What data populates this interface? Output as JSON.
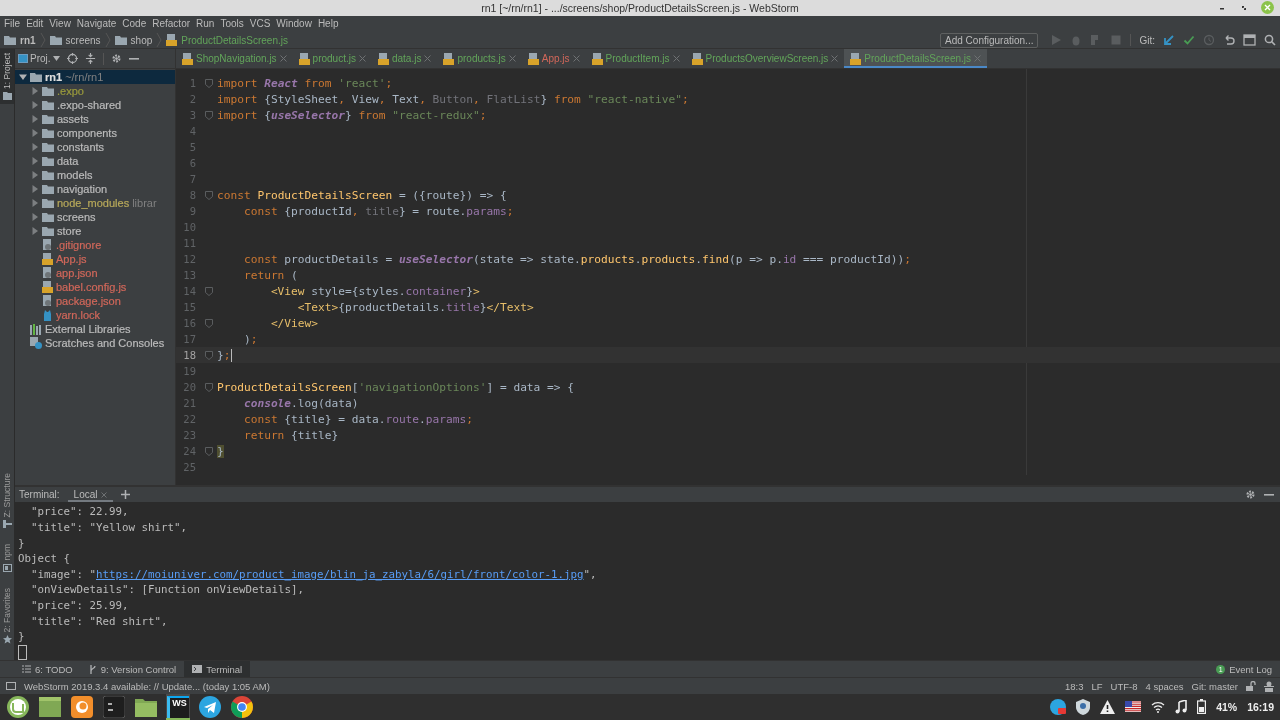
{
  "window": {
    "title": "rn1 [~/rn/rn1] - .../screens/shop/ProductDetailsScreen.js - WebStorm"
  },
  "menu": [
    "File",
    "Edit",
    "View",
    "Navigate",
    "Code",
    "Refactor",
    "Run",
    "Tools",
    "VCS",
    "Window",
    "Help"
  ],
  "breadcrumbs": [
    {
      "label": "rn1",
      "kind": "root"
    },
    {
      "label": "screens",
      "kind": "folder"
    },
    {
      "label": "shop",
      "kind": "folder"
    },
    {
      "label": "ProductDetailsScreen.js",
      "kind": "file"
    }
  ],
  "toolbar": {
    "config_button": "Add Configuration...",
    "git_label": "Git:"
  },
  "side_tools": [
    {
      "label": "1: Project",
      "kind": "project",
      "selected": true
    },
    {
      "label": "Z: Structure",
      "kind": "structure",
      "selected": false
    },
    {
      "label": "npm",
      "kind": "npm",
      "selected": false
    },
    {
      "label": "2: Favorites",
      "kind": "favorites",
      "selected": false
    }
  ],
  "project_panel": {
    "view": "Proj."
  },
  "project_tree": [
    {
      "label": "rn1",
      "hint": "~/rn/rn1",
      "kind": "root",
      "expanded": true,
      "selected": true,
      "children": [
        {
          "label": ".expo",
          "kind": "folder",
          "color": "#9a9a3c",
          "expanded": false,
          "selected": false
        },
        {
          "label": ".expo-shared",
          "kind": "folder",
          "color": "#bbbbbb",
          "expanded": false,
          "selected": false
        },
        {
          "label": "assets",
          "kind": "folder",
          "color": "#bbbbbb",
          "expanded": false,
          "selected": false
        },
        {
          "label": "components",
          "kind": "folder",
          "color": "#bbbbbb",
          "expanded": false,
          "selected": false
        },
        {
          "label": "constants",
          "kind": "folder",
          "color": "#bbbbbb",
          "expanded": false,
          "selected": false
        },
        {
          "label": "data",
          "kind": "folder",
          "color": "#bbbbbb",
          "expanded": false,
          "selected": false
        },
        {
          "label": "models",
          "kind": "folder",
          "color": "#bbbbbb",
          "expanded": false,
          "selected": false
        },
        {
          "label": "navigation",
          "kind": "folder",
          "color": "#bbbbbb",
          "expanded": false,
          "selected": false
        },
        {
          "label": "node_modules",
          "hint": "librar",
          "kind": "folder",
          "color": "#b8a95a",
          "expanded": false,
          "selected": false
        },
        {
          "label": "screens",
          "kind": "folder",
          "color": "#bbbbbb",
          "expanded": false,
          "selected": false
        },
        {
          "label": "store",
          "kind": "folder",
          "color": "#bbbbbb",
          "expanded": false,
          "selected": false
        },
        {
          "label": ".gitignore",
          "kind": "config",
          "color": "#d1675a",
          "selected": false
        },
        {
          "label": "App.js",
          "kind": "js",
          "color": "#d1675a",
          "selected": false
        },
        {
          "label": "app.json",
          "kind": "config",
          "color": "#d1675a",
          "selected": false
        },
        {
          "label": "babel.config.js",
          "kind": "js",
          "color": "#d1675a",
          "selected": false
        },
        {
          "label": "package.json",
          "kind": "config",
          "color": "#d1675a",
          "selected": false
        },
        {
          "label": "yarn.lock",
          "kind": "lock",
          "color": "#d1675a",
          "selected": false
        }
      ]
    },
    {
      "label": "External Libraries",
      "kind": "libraries",
      "color": "#bbbbbb",
      "selected": false
    },
    {
      "label": "Scratches and Consoles",
      "kind": "scratches",
      "color": "#bbbbbb",
      "selected": false
    }
  ],
  "tabs": [
    {
      "label": "ShopNavigation.js",
      "color": "#62a55a",
      "selected": false
    },
    {
      "label": "product.js",
      "color": "#62a55a",
      "selected": false
    },
    {
      "label": "data.js",
      "color": "#62a55a",
      "selected": false
    },
    {
      "label": "products.js",
      "color": "#62a55a",
      "selected": false
    },
    {
      "label": "App.js",
      "color": "#d1675a",
      "selected": false
    },
    {
      "label": "ProductItem.js",
      "color": "#62a55a",
      "selected": false
    },
    {
      "label": "ProductsOverviewScreen.js",
      "color": "#62a55a",
      "selected": false
    },
    {
      "label": "ProductDetailsScreen.js",
      "color": "#62a55a",
      "selected": true
    }
  ],
  "editor": {
    "lines": [
      {
        "n": "1",
        "fold": true,
        "current": false,
        "tokens": [
          {
            "kind": "kw",
            "text": "import "
          },
          {
            "kind": "it",
            "text": "React"
          },
          {
            "kind": "kw",
            "text": " from "
          },
          {
            "kind": "str",
            "text": "'react'"
          },
          {
            "kind": "kw",
            "text": ";"
          }
        ]
      },
      {
        "n": "2",
        "fold": false,
        "current": false,
        "tokens": [
          {
            "kind": "kw",
            "text": "import "
          },
          {
            "kind": "pl",
            "text": "{StyleSheet"
          },
          {
            "kind": "kw",
            "text": ", "
          },
          {
            "kind": "pl",
            "text": "View"
          },
          {
            "kind": "kw",
            "text": ", "
          },
          {
            "kind": "pl",
            "text": "Text"
          },
          {
            "kind": "kw",
            "text": ", "
          },
          {
            "kind": "un",
            "text": "Button"
          },
          {
            "kind": "kw",
            "text": ", "
          },
          {
            "kind": "un",
            "text": "FlatList"
          },
          {
            "kind": "pl",
            "text": "}"
          },
          {
            "kind": "kw",
            "text": " from "
          },
          {
            "kind": "str",
            "text": "\"react-native\""
          },
          {
            "kind": "kw",
            "text": ";"
          }
        ]
      },
      {
        "n": "3",
        "fold": true,
        "current": false,
        "tokens": [
          {
            "kind": "kw",
            "text": "import "
          },
          {
            "kind": "pl",
            "text": "{"
          },
          {
            "kind": "it",
            "text": "useSelector"
          },
          {
            "kind": "pl",
            "text": "} "
          },
          {
            "kind": "kw",
            "text": "from "
          },
          {
            "kind": "str",
            "text": "\"react-redux\""
          },
          {
            "kind": "kw",
            "text": ";"
          }
        ]
      },
      {
        "n": "4",
        "fold": false,
        "current": false
      },
      {
        "n": "5",
        "fold": false,
        "current": false
      },
      {
        "n": "6",
        "fold": false,
        "current": false
      },
      {
        "n": "7",
        "fold": false,
        "current": false
      },
      {
        "n": "8",
        "fold": true,
        "current": false,
        "tokens": [
          {
            "kind": "kw",
            "text": "const "
          },
          {
            "kind": "fn",
            "text": "ProductDetailsScreen"
          },
          {
            "kind": "pl",
            "text": " = ({route}) => {"
          }
        ]
      },
      {
        "n": "9",
        "fold": false,
        "current": false,
        "tokens": [
          {
            "kind": "kw",
            "text": "    const "
          },
          {
            "kind": "pl",
            "text": "{productId"
          },
          {
            "kind": "kw",
            "text": ", "
          },
          {
            "kind": "un",
            "text": "title"
          },
          {
            "kind": "pl",
            "text": "} = route."
          },
          {
            "kind": "fd",
            "text": "params"
          },
          {
            "kind": "kw",
            "text": ";"
          }
        ]
      },
      {
        "n": "10",
        "fold": false,
        "current": false
      },
      {
        "n": "11",
        "fold": false,
        "current": false
      },
      {
        "n": "12",
        "fold": false,
        "current": false,
        "tokens": [
          {
            "kind": "kw",
            "text": "    const "
          },
          {
            "kind": "pl",
            "text": "productDetails = "
          },
          {
            "kind": "it",
            "text": "useSelector"
          },
          {
            "kind": "pl",
            "text": "(state => state."
          },
          {
            "kind": "fn",
            "text": "products"
          },
          {
            "kind": "pl",
            "text": "."
          },
          {
            "kind": "fn",
            "text": "products"
          },
          {
            "kind": "pl",
            "text": "."
          },
          {
            "kind": "fn",
            "text": "find"
          },
          {
            "kind": "pl",
            "text": "(p => p."
          },
          {
            "kind": "fd",
            "text": "id"
          },
          {
            "kind": "pl",
            "text": " === productId))"
          },
          {
            "kind": "kw",
            "text": ";"
          }
        ]
      },
      {
        "n": "13",
        "fold": false,
        "current": false,
        "tokens": [
          {
            "kind": "kw",
            "text": "    return "
          },
          {
            "kind": "pl",
            "text": "("
          }
        ]
      },
      {
        "n": "14",
        "fold": true,
        "current": false,
        "tokens": [
          {
            "kind": "tg",
            "text": "        <View "
          },
          {
            "kind": "pl",
            "text": "style={styles."
          },
          {
            "kind": "fd",
            "text": "container"
          },
          {
            "kind": "pl",
            "text": "}"
          },
          {
            "kind": "tg",
            "text": ">"
          }
        ]
      },
      {
        "n": "15",
        "fold": false,
        "current": false,
        "tokens": [
          {
            "kind": "tg",
            "text": "            <Text>"
          },
          {
            "kind": "pl",
            "text": "{productDetails."
          },
          {
            "kind": "fd",
            "text": "title"
          },
          {
            "kind": "pl",
            "text": "}"
          },
          {
            "kind": "tg",
            "text": "</Text>"
          }
        ]
      },
      {
        "n": "16",
        "fold": true,
        "current": false,
        "tokens": [
          {
            "kind": "tg",
            "text": "        </View>"
          }
        ]
      },
      {
        "n": "17",
        "fold": false,
        "current": false,
        "tokens": [
          {
            "kind": "pl",
            "text": "    )"
          },
          {
            "kind": "kw",
            "text": ";"
          }
        ]
      },
      {
        "n": "18",
        "fold": true,
        "current": true,
        "tokens": [
          {
            "kind": "pl",
            "text": "}"
          },
          {
            "kind": "kw",
            "text": ";"
          }
        ]
      },
      {
        "n": "19",
        "fold": false,
        "current": false
      },
      {
        "n": "20",
        "fold": true,
        "current": false,
        "tokens": [
          {
            "kind": "fn",
            "text": "ProductDetailsScreen"
          },
          {
            "kind": "pl",
            "text": "["
          },
          {
            "kind": "str",
            "text": "'navigationOptions'"
          },
          {
            "kind": "pl",
            "text": "] = data => {"
          }
        ]
      },
      {
        "n": "21",
        "fold": false,
        "current": false,
        "tokens": [
          {
            "kind": "it",
            "text": "    console"
          },
          {
            "kind": "pl",
            "text": ".log(data)"
          }
        ]
      },
      {
        "n": "22",
        "fold": false,
        "current": false,
        "tokens": [
          {
            "kind": "kw",
            "text": "    const "
          },
          {
            "kind": "pl",
            "text": "{title} = data."
          },
          {
            "kind": "fd",
            "text": "route"
          },
          {
            "kind": "pl",
            "text": "."
          },
          {
            "kind": "fd",
            "text": "params"
          },
          {
            "kind": "kw",
            "text": ";"
          }
        ]
      },
      {
        "n": "23",
        "fold": false,
        "current": false,
        "tokens": [
          {
            "kind": "kw",
            "text": "    return "
          },
          {
            "kind": "pl",
            "text": "{title}"
          }
        ]
      },
      {
        "n": "24",
        "fold": true,
        "current": false,
        "tokens": [
          {
            "kind": "hl",
            "text": "}"
          }
        ]
      },
      {
        "n": "25",
        "fold": false,
        "current": false
      }
    ]
  },
  "terminal": {
    "title": "Terminal:",
    "sessions": [
      {
        "label": "Local",
        "selected": true
      }
    ],
    "lines": [
      {
        "text": "  \"price\": 22.99,"
      },
      {
        "text": "  \"title\": \"Yellow shirt\","
      },
      {
        "text": "}"
      },
      {
        "text": "Object {"
      },
      {
        "text": "  \"image\": \"",
        "link": "https://moiuniver.com/product_image/blin_ja_zabyla/6/girl/front/color-1.jpg",
        "after": "\","
      },
      {
        "text": "  \"onViewDetails\": [Function onViewDetails],"
      },
      {
        "text": "  \"price\": 25.99,"
      },
      {
        "text": "  \"title\": \"Red shirt\","
      },
      {
        "text": "}"
      }
    ]
  },
  "tool_tabs": [
    {
      "label": "6: TODO",
      "kind": "todo",
      "selected": false
    },
    {
      "label": "9: Version Control",
      "kind": "vcs",
      "selected": false
    },
    {
      "label": "Terminal",
      "kind": "terminal",
      "selected": true
    }
  ],
  "event_log": {
    "label": "Event Log",
    "count": "1"
  },
  "status_bar": {
    "message": "WebStorm 2019.3.4 available: // Update... (today 1:05 AM)",
    "position": "18:3",
    "line_separator": "LF",
    "encoding": "UTF-8",
    "indent": "4 spaces",
    "branch": "Git: master"
  },
  "taskbar": {
    "apps": [
      {
        "kind": "menu",
        "selected": false
      },
      {
        "kind": "window",
        "selected": false
      },
      {
        "kind": "swirl",
        "selected": false
      },
      {
        "kind": "terminal",
        "selected": false
      },
      {
        "kind": "folder",
        "selected": false
      },
      {
        "kind": "ide",
        "label": "WS",
        "selected": true
      },
      {
        "kind": "plane",
        "selected": false
      },
      {
        "kind": "browser",
        "selected": false
      }
    ],
    "battery": "41%",
    "clock": "16:19"
  }
}
